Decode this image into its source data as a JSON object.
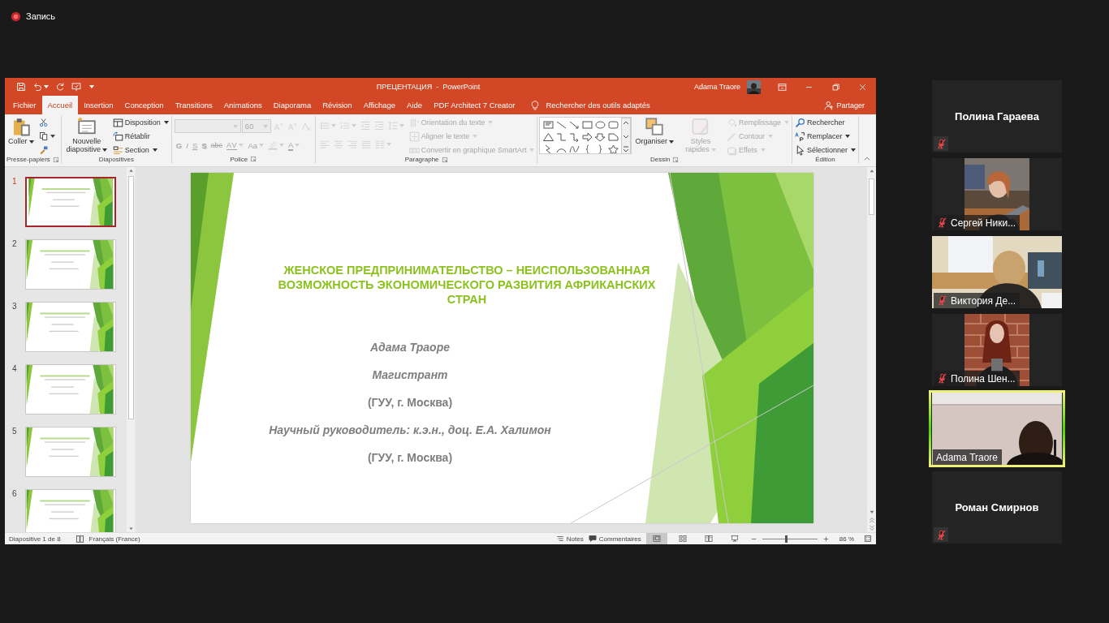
{
  "recording": {
    "label": "Запись"
  },
  "window": {
    "title": "ПРЕЦЕНТАЦИЯ  -  PowerPoint",
    "user": "Adama Traore"
  },
  "tabs": [
    {
      "label": "Fichier",
      "selected": false
    },
    {
      "label": "Accueil",
      "selected": true
    },
    {
      "label": "Insertion",
      "selected": false
    },
    {
      "label": "Conception",
      "selected": false
    },
    {
      "label": "Transitions",
      "selected": false
    },
    {
      "label": "Animations",
      "selected": false
    },
    {
      "label": "Diaporama",
      "selected": false
    },
    {
      "label": "Révision",
      "selected": false
    },
    {
      "label": "Affichage",
      "selected": false
    },
    {
      "label": "Aide",
      "selected": false
    },
    {
      "label": "PDF Architect 7 Creator",
      "selected": false
    }
  ],
  "tell_me": {
    "label": "Rechercher des outils adaptés"
  },
  "share": {
    "label": "Partager"
  },
  "ribbon": {
    "groups": [
      {
        "label": "Presse-papiers",
        "launcher": true,
        "blocks": [
          {
            "kind": "column",
            "controls": [
              {
                "kind": "large",
                "label": "Coller",
                "dropdown": true,
                "disabled": false
              }
            ]
          },
          {
            "kind": "column",
            "controls": [
              {
                "kind": "icon",
                "dropdown": false,
                "disabled": false
              },
              {
                "kind": "icon",
                "dropdown": true,
                "disabled": false
              },
              {
                "kind": "icon",
                "dropdown": false,
                "disabled": false
              }
            ]
          }
        ]
      },
      {
        "label": "Diapositives",
        "launcher": false,
        "blocks": [
          {
            "kind": "column",
            "controls": [
              {
                "kind": "large",
                "label": "Nouvelle diapositive",
                "dropdown": true,
                "disabled": false
              }
            ]
          },
          {
            "kind": "column",
            "controls": [
              {
                "kind": "small",
                "label": "Disposition",
                "dropdown": true,
                "disabled": false
              },
              {
                "kind": "small",
                "label": "Rétablir",
                "dropdown": false,
                "disabled": false
              },
              {
                "kind": "small",
                "label": "Section",
                "dropdown": true,
                "disabled": false
              }
            ]
          }
        ]
      },
      {
        "label": "Police",
        "launcher": true,
        "blocks": [
          {
            "kind": "rows",
            "lines": [
              {
                "controls": [
                  {
                    "kind": "font_field",
                    "dropdown": true,
                    "disabled": true
                  },
                  {
                    "kind": "size_field",
                    "value": "60",
                    "dropdown": true,
                    "disabled": true
                  },
                  {
                    "kind": "icon",
                    "dropdown": false,
                    "disabled": true
                  },
                  {
                    "kind": "icon",
                    "dropdown": false,
                    "disabled": true
                  },
                  {
                    "kind": "icon",
                    "dropdown": false,
                    "disabled": true
                  }
                ]
              },
              {
                "controls": [
                  {
                    "kind": "bold",
                    "label": "G",
                    "dropdown": false,
                    "disabled": true
                  },
                  {
                    "kind": "italic",
                    "label": "I",
                    "dropdown": false,
                    "disabled": true
                  },
                  {
                    "kind": "underline",
                    "label": "S",
                    "dropdown": false,
                    "disabled": true
                  },
                  {
                    "kind": "shadow",
                    "label": "S",
                    "dropdown": false,
                    "disabled": true
                  },
                  {
                    "kind": "strike",
                    "label": "abc",
                    "dropdown": false,
                    "disabled": true
                  },
                  {
                    "kind": "spacing",
                    "label": "AV",
                    "dropdown": true,
                    "disabled": true
                  },
                  {
                    "kind": "case",
                    "label": "Aa",
                    "dropdown": true,
                    "disabled": true
                  },
                  {
                    "kind": "icon",
                    "dropdown": true,
                    "disabled": true
                  },
                  {
                    "kind": "color",
                    "label": "A",
                    "dropdown": true,
                    "disabled": true
                  }
                ]
              }
            ]
          }
        ]
      },
      {
        "label": "Paragraphe",
        "launcher": true,
        "blocks": [
          {
            "kind": "rows",
            "lines": [
              {
                "controls": [
                  {
                    "kind": "icon",
                    "dropdown": true,
                    "disabled": true
                  },
                  {
                    "kind": "icon",
                    "dropdown": true,
                    "disabled": true
                  },
                  {
                    "kind": "icon",
                    "dropdown": false,
                    "disabled": true
                  },
                  {
                    "kind": "icon",
                    "dropdown": false,
                    "disabled": true
                  },
                  {
                    "kind": "icon",
                    "dropdown": true,
                    "disabled": true
                  }
                ]
              },
              {
                "controls": [
                  {
                    "kind": "icon",
                    "dropdown": false,
                    "disabled": true
                  },
                  {
                    "kind": "icon",
                    "dropdown": false,
                    "disabled": true
                  },
                  {
                    "kind": "icon",
                    "dropdown": false,
                    "disabled": true
                  },
                  {
                    "kind": "icon",
                    "dropdown": false,
                    "disabled": true
                  },
                  {
                    "kind": "icon",
                    "dropdown": true,
                    "disabled": true
                  }
                ]
              }
            ]
          },
          {
            "kind": "column",
            "controls": [
              {
                "kind": "small",
                "label": "Orientation du texte",
                "dropdown": true,
                "disabled": true
              },
              {
                "kind": "small",
                "label": "Aligner le texte",
                "dropdown": true,
                "disabled": true
              },
              {
                "kind": "small",
                "label": "Convertir en graphique SmartArt",
                "dropdown": true,
                "disabled": true
              }
            ]
          }
        ]
      },
      {
        "label": "Dessin",
        "launcher": true,
        "blocks": [
          {
            "kind": "column",
            "controls": [
              {
                "kind": "gallery",
                "disabled": false
              }
            ]
          },
          {
            "kind": "column",
            "controls": [
              {
                "kind": "large",
                "label": "Organiser",
                "dropdown": true,
                "disabled": false
              }
            ]
          },
          {
            "kind": "column",
            "controls": [
              {
                "kind": "large",
                "label": "Styles rapides",
                "dropdown": true,
                "disabled": true
              }
            ]
          },
          {
            "kind": "column",
            "controls": [
              {
                "kind": "small",
                "label": "Remplissage",
                "dropdown": true,
                "disabled": true
              },
              {
                "kind": "small",
                "label": "Contour",
                "dropdown": true,
                "disabled": true
              },
              {
                "kind": "small",
                "label": "Effets",
                "dropdown": true,
                "disabled": true
              }
            ]
          }
        ]
      },
      {
        "label": "Édition",
        "launcher": false,
        "blocks": [
          {
            "kind": "column",
            "controls": [
              {
                "kind": "small",
                "label": "Rechercher",
                "dropdown": false,
                "disabled": false
              },
              {
                "kind": "small",
                "label": "Remplacer",
                "dropdown": true,
                "disabled": false
              },
              {
                "kind": "small",
                "label": "Sélectionner",
                "dropdown": true,
                "disabled": false
              }
            ]
          }
        ]
      }
    ]
  },
  "slides": [
    {
      "number": "1",
      "selected": true
    },
    {
      "number": "2",
      "selected": false
    },
    {
      "number": "3",
      "selected": false
    },
    {
      "number": "4",
      "selected": false
    },
    {
      "number": "5",
      "selected": false
    },
    {
      "number": "6",
      "selected": false
    }
  ],
  "slide": {
    "title": "ЖЕНСКОЕ ПРЕДПРИНИМАТЕЛЬСТВО – НЕИСПОЛЬЗОВАННАЯ ВОЗМОЖНОСТЬ ЭКОНОМИЧЕСКОГО РАЗВИТИЯ АФРИКАНСКИХ СТРАН",
    "lines": [
      {
        "text": "Адама Траоре",
        "italic": true
      },
      {
        "text": "Магистрант",
        "italic": true
      },
      {
        "text": "(ГУУ, г. Москва)",
        "italic": false
      },
      {
        "text": "Научный руководитель: к.э.н., доц. Е.А. Халимон",
        "italic": true
      },
      {
        "text": "(ГУУ, г. Москва)",
        "italic": false
      }
    ]
  },
  "status_bar": {
    "slide_info": "Diapositive 1 de 8",
    "language": "Français (France)",
    "notes": "Notes",
    "comments": "Commentaires",
    "views": [
      {
        "selected": true
      },
      {
        "selected": false
      },
      {
        "selected": false
      },
      {
        "selected": false
      }
    ],
    "zoom": {
      "level": 0.43,
      "reading": "86 %"
    }
  },
  "participants": [
    {
      "name": "Полина Гараева",
      "kind": "name",
      "muted": true,
      "active": false
    },
    {
      "name": "Сергей Ники...",
      "kind": "narrow_video",
      "muted": true,
      "active": false
    },
    {
      "name": "Виктория Де...",
      "kind": "video",
      "muted": true,
      "active": false
    },
    {
      "name": "Полина Шен...",
      "kind": "narrow_video",
      "muted": true,
      "active": false
    },
    {
      "name": "Adama Traore",
      "kind": "video",
      "muted": false,
      "active": true
    },
    {
      "name": "Роман Смирнов",
      "kind": "name",
      "muted": true,
      "active": false
    }
  ]
}
